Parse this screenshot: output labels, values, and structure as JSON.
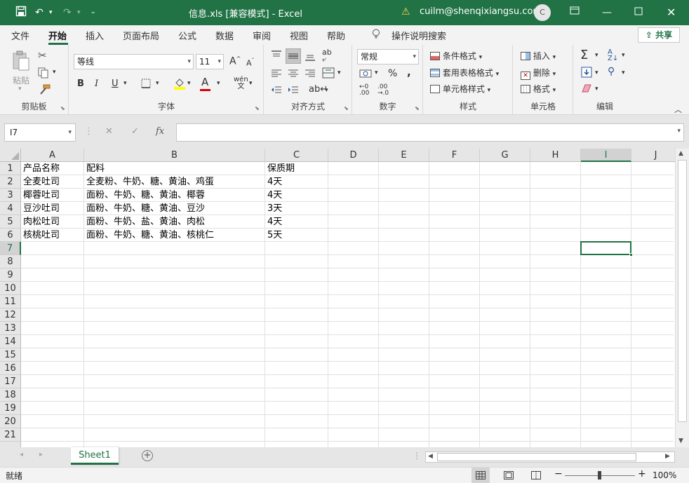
{
  "titlebar": {
    "title": "信息.xls  [兼容模式]  -  Excel",
    "account": "cuilm@shenqixiangsu.com",
    "avatar_initial": "C"
  },
  "menu": {
    "items": [
      "文件",
      "开始",
      "插入",
      "页面布局",
      "公式",
      "数据",
      "审阅",
      "视图",
      "帮助"
    ],
    "tell_me": "操作说明搜索",
    "share": "共享"
  },
  "ribbon": {
    "clipboard": {
      "paste": "粘贴",
      "label": "剪贴板"
    },
    "font": {
      "name": "等线",
      "size": "11",
      "label": "字体",
      "bold": "B",
      "italic": "I",
      "underline": "U",
      "grow": "A",
      "shrink": "A",
      "color_a": "A",
      "wen": "wén"
    },
    "alignment": {
      "label": "对齐方式"
    },
    "number": {
      "format": "常规",
      "label": "数字",
      "percent": "%",
      "comma": ","
    },
    "styles": {
      "conditional": "条件格式",
      "table": "套用表格格式",
      "cell": "单元格样式",
      "label": "样式"
    },
    "cells": {
      "insert": "插入",
      "delete": "删除",
      "format": "格式",
      "label": "单元格"
    },
    "editing": {
      "label": "编辑"
    }
  },
  "formula_bar": {
    "name_box": "I7",
    "formula": ""
  },
  "sheet": {
    "columns": [
      "A",
      "B",
      "C",
      "D",
      "E",
      "F",
      "G",
      "H",
      "I",
      "J"
    ],
    "rows": [
      "1",
      "2",
      "3",
      "4",
      "5",
      "6",
      "7",
      "8",
      "9",
      "10",
      "11",
      "12",
      "13",
      "14",
      "15",
      "16",
      "17",
      "18",
      "19",
      "20",
      "21"
    ],
    "cells": [
      [
        "产品名称",
        "配料",
        "保质期"
      ],
      [
        "全麦吐司",
        "全麦粉、牛奶、糖、黄油、鸡蛋",
        "4天"
      ],
      [
        "椰蓉吐司",
        "面粉、牛奶、糖、黄油、椰蓉",
        "4天"
      ],
      [
        "豆沙吐司",
        "面粉、牛奶、糖、黄油、豆沙",
        "3天"
      ],
      [
        "肉松吐司",
        "面粉、牛奶、盐、黄油、肉松",
        "4天"
      ],
      [
        "核桃吐司",
        "面粉、牛奶、糖、黄油、核桃仁",
        "5天"
      ]
    ],
    "selected_cell": "I7"
  },
  "tabs": {
    "sheet": "Sheet1"
  },
  "status": {
    "mode": "就绪",
    "zoom": "100%"
  },
  "colors": {
    "accent": "#217346"
  }
}
